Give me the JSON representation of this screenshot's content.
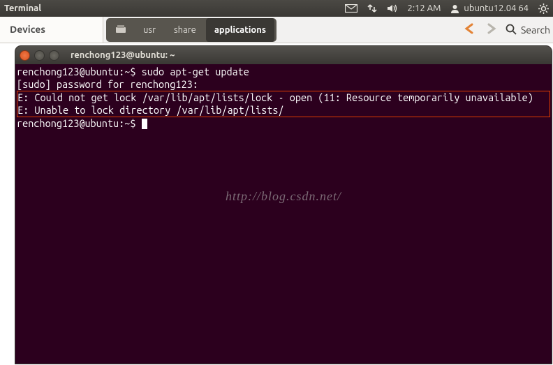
{
  "panel": {
    "app_title": "Terminal",
    "time": "2:12 AM",
    "user": "ubuntu12.04 64"
  },
  "devices": {
    "label": "Devices"
  },
  "breadcrumb": {
    "items": [
      {
        "label": "usr"
      },
      {
        "label": "share"
      },
      {
        "label": "applications",
        "active": true
      }
    ]
  },
  "search": {
    "placeholder": "Search"
  },
  "terminal": {
    "title": "renchong123@ubuntu: ~",
    "lines": {
      "l1": "renchong123@ubuntu:~$ sudo apt-get update",
      "l2": "[sudo] password for renchong123:",
      "e1": "E: Could not get lock /var/lib/apt/lists/lock - open (11: Resource temporarily unavailable)",
      "e2": "E: Unable to lock directory /var/lib/apt/lists/",
      "l3": "renchong123@ubuntu:~$ "
    },
    "watermark": "http://blog.csdn.net/"
  }
}
